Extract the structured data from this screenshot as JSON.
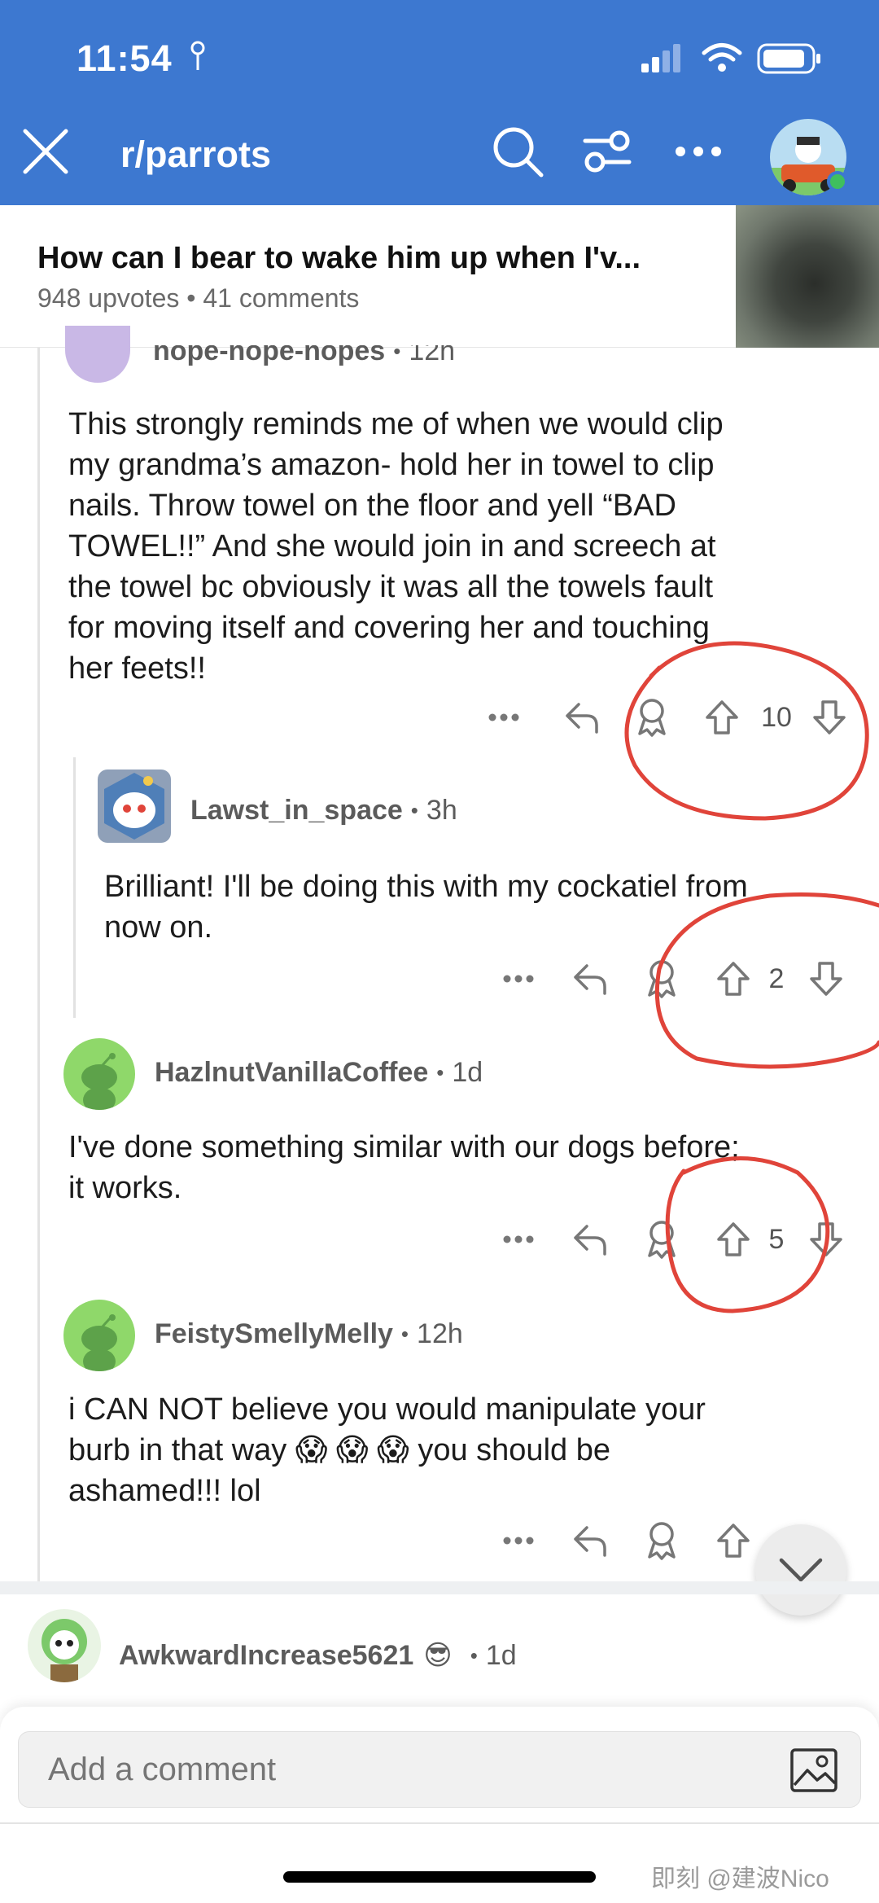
{
  "status_bar": {
    "time": "11:54"
  },
  "header": {
    "subreddit": "r/parrots"
  },
  "post": {
    "title": "How can I bear to wake him up when I'v...",
    "meta": "948 upvotes • 41 comments"
  },
  "comments": [
    {
      "author": "nope-nope-nopes",
      "age": "12h",
      "body": [
        "This strongly reminds me of when we would clip",
        "my grandma’s amazon- hold her in towel to clip",
        "nails. Throw towel on the floor and yell “BAD",
        "TOWEL!!” And she would join in and screech at",
        "the towel bc obviously it was all the towels fault",
        "for moving itself and covering her and touching",
        "her feets!!"
      ],
      "score": "10"
    },
    {
      "author": "Lawst_in_space",
      "age": "3h",
      "body": [
        "Brilliant! I'll be doing this with my cockatiel from",
        "now on."
      ],
      "score": "2"
    },
    {
      "author": "HazlnutVanillaCoffee",
      "age": "1d",
      "body": [
        "I've done something similar with our dogs before;",
        "it works."
      ],
      "score": "5"
    },
    {
      "author": "FeistySmellyMelly",
      "age": "12h",
      "body": [
        "i CAN NOT believe you would manipulate your",
        "burb in that way 😱 😱 😱 you should be",
        "ashamed!!!  lol"
      ],
      "score": ""
    },
    {
      "author": "AwkwardIncrease5621",
      "age": "1d",
      "flair_emoji": "😎"
    }
  ],
  "separator": "•",
  "composer": {
    "placeholder": "Add a comment"
  },
  "watermark": "即刻 @建波Nico",
  "colors": {
    "header_bg": "#3d78d0",
    "annotation_red": "#e0443a",
    "avatar_green": "#8fd86a"
  }
}
